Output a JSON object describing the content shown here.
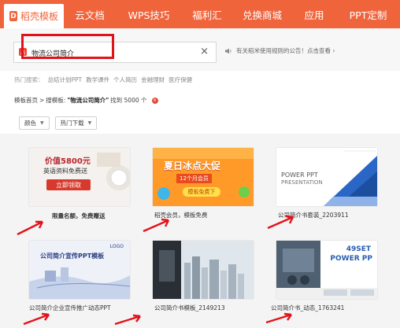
{
  "nav": {
    "tabs": [
      {
        "label": "稻壳模板",
        "active": true
      },
      {
        "label": "云文档"
      },
      {
        "label": "WPS技巧"
      },
      {
        "label": "福利汇"
      },
      {
        "label": "兑换商城"
      },
      {
        "label": "应用"
      },
      {
        "label": "PPT定制"
      }
    ]
  },
  "search": {
    "value": "物流公司简介",
    "notice": "有关稻米使用规则的公告！点击查看 ›"
  },
  "hot": {
    "label": "热门搜索：",
    "items": [
      "总结计划PPT",
      "教学课件",
      "个人简历",
      "金融理财",
      "医疗保健"
    ]
  },
  "breadcrumb": {
    "home": "模板首页",
    "sep": ">",
    "prefix": "搜模板:",
    "query": "\"物流公司简介\"",
    "count": "找到 5000 个"
  },
  "filters": [
    {
      "label": "颜色"
    },
    {
      "label": "热门下载"
    }
  ],
  "cards": [
    {
      "caption": "限量名额，免费赠送",
      "thumb": {
        "t1": "价值5800元",
        "t2": "英语资料免费送",
        "btn": "立即领取"
      }
    },
    {
      "caption": "稻壳会员，模板免费",
      "thumb": {
        "t1": "夏日冰点大促",
        "t2": "12个月会员",
        "btn": "模板免费下"
      }
    },
    {
      "caption": "公司简介书套装_2203911",
      "thumb": {
        "t1": "POWER PPT",
        "t2": "PRESENTATION"
      }
    },
    {
      "caption": "公司简介企业宣传推广动态PPT",
      "thumb": {
        "t1": "公司简介宣传PPT模板",
        "t2": "LOGO"
      }
    },
    {
      "caption": "公司简介书模板_2149213",
      "thumb": {
        "t1": ""
      }
    },
    {
      "caption": "公司简介书_动态_1763241",
      "thumb": {
        "t1": "49SET",
        "t2": "POWER PP"
      }
    }
  ]
}
